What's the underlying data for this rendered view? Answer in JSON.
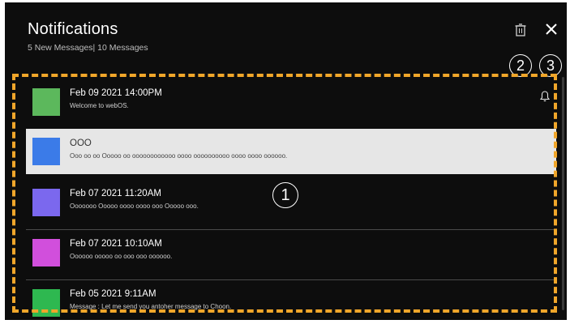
{
  "header": {
    "title": "Notifications",
    "subtitle": "5 New Messages| 10 Messages"
  },
  "callouts": {
    "list": "1",
    "delete": "2",
    "close": "3"
  },
  "notifications": [
    {
      "headline": "Feb 09 2021 14:00PM",
      "body": "Welcome to webOS.",
      "color": "#5cb85c",
      "bell": true
    },
    {
      "headline": "OOO",
      "body": "Ooo oo oo Ooooo oo oooooooooooo oooo oooooooooo oooo oooo oooooo.",
      "color": "#3b7be8",
      "selected": true
    },
    {
      "headline": "Feb 07 2021 11:20AM",
      "body": "Ooooooo Ooooo oooo oooo ooo Ooooo ooo.",
      "color": "#7b68ee"
    },
    {
      "headline": "Feb 07 2021 10:10AM",
      "body": "Oooooo ooooo oo ooo ooo oooooo.",
      "color": "#d14fdc"
    },
    {
      "headline": "Feb 05 2021 9:11AM",
      "body": "Message : Let me send you antoher message to Choon.",
      "color": "#2eb850"
    }
  ],
  "colors": {
    "highlight_frame": "#f0a62a",
    "background": "#0d0d0d"
  }
}
